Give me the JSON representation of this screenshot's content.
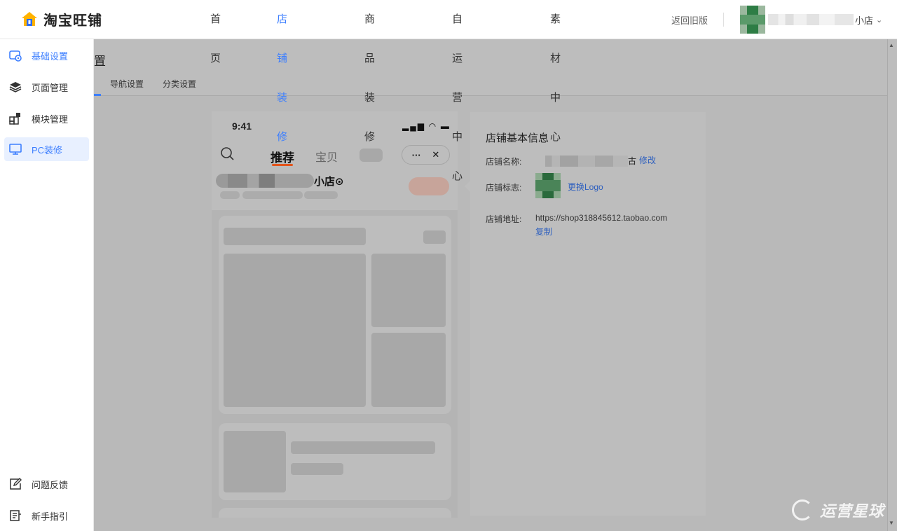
{
  "header": {
    "logo_text": "淘宝旺铺",
    "nav": [
      "首页",
      "店铺装修",
      "商品装修",
      "自运营中心",
      "素材中心"
    ],
    "active_nav": "店铺装修",
    "back_old": "返回旧版",
    "user_suffix": "小店",
    "user_caret": "⌄"
  },
  "sidebar": {
    "items": [
      {
        "label": "基础设置",
        "icon": "store-settings-icon"
      },
      {
        "label": "页面管理",
        "icon": "layers-icon"
      },
      {
        "label": "模块管理",
        "icon": "modules-icon"
      },
      {
        "label": "PC装修",
        "icon": "monitor-icon"
      }
    ],
    "bottom_items": [
      {
        "label": "问题反馈",
        "icon": "edit-feedback-icon"
      },
      {
        "label": "新手指引",
        "icon": "guide-doc-icon"
      }
    ]
  },
  "page": {
    "title_partial": "置",
    "tabs": [
      "导航设置",
      "分类设置"
    ]
  },
  "phone": {
    "time": "9:41",
    "status_icons": "▂▄▆ ◠ ▬",
    "tab_recommend": "推荐",
    "tab_items": "宝贝",
    "capsule_more": "···",
    "capsule_close": "✕",
    "shop_name": "小店⊙"
  },
  "info": {
    "title": "店铺基本信息",
    "name_label": "店铺名称:",
    "name_suffix": "古",
    "modify": "修改",
    "logo_label": "店铺标志:",
    "replace_logo": "更换Logo",
    "addr_label": "店铺地址:",
    "addr_value": "https://shop318845612.taobao.com",
    "copy": "复制"
  },
  "watermark": {
    "text": "运营星球"
  },
  "colors": {
    "accent": "#3d7fff",
    "overlay": "#b9b9b9",
    "link": "#2d5fbf",
    "tab_underline": "#e2541b"
  }
}
